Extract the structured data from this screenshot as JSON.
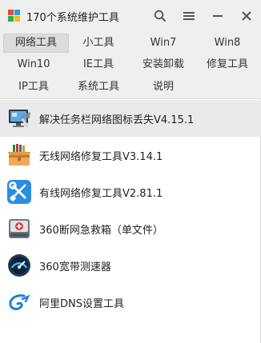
{
  "window": {
    "title": "170个系统维护工具"
  },
  "titlebar_icons": [
    "search-icon",
    "menu-icon",
    "minimize-icon",
    "close-icon"
  ],
  "tabs": [
    {
      "label": "网络工具",
      "active": true
    },
    {
      "label": "小工具",
      "active": false
    },
    {
      "label": "Win7",
      "active": false
    },
    {
      "label": "Win8",
      "active": false
    },
    {
      "label": "Win10",
      "active": false
    },
    {
      "label": "IE工具",
      "active": false
    },
    {
      "label": "安装卸载",
      "active": false
    },
    {
      "label": "修复工具",
      "active": false
    },
    {
      "label": "IP工具",
      "active": false
    },
    {
      "label": "系统工具",
      "active": false
    },
    {
      "label": "说明",
      "active": false
    }
  ],
  "tools": [
    {
      "label": "解决任务栏网络图标丢失V4.15.1",
      "icon": "monitor-network-icon",
      "selected": true
    },
    {
      "label": "无线网络修复工具V3.14.1",
      "icon": "toolbox-icon",
      "selected": false
    },
    {
      "label": "有线网络修复工具V2.81.1",
      "icon": "wrench-screwdriver-icon",
      "selected": false
    },
    {
      "label": "360断网急救箱（单文件）",
      "icon": "first-aid-kit-icon",
      "selected": false
    },
    {
      "label": "360宽带测速器",
      "icon": "speedometer-icon",
      "selected": false
    },
    {
      "label": "阿里DNS设置工具",
      "icon": "aliyun-logo-icon",
      "selected": false
    }
  ],
  "colors": {
    "titlebar_bg": "#efefef",
    "tab_active_bg": "#dcdcdc",
    "selected_row_bg": "#eaeaea"
  }
}
